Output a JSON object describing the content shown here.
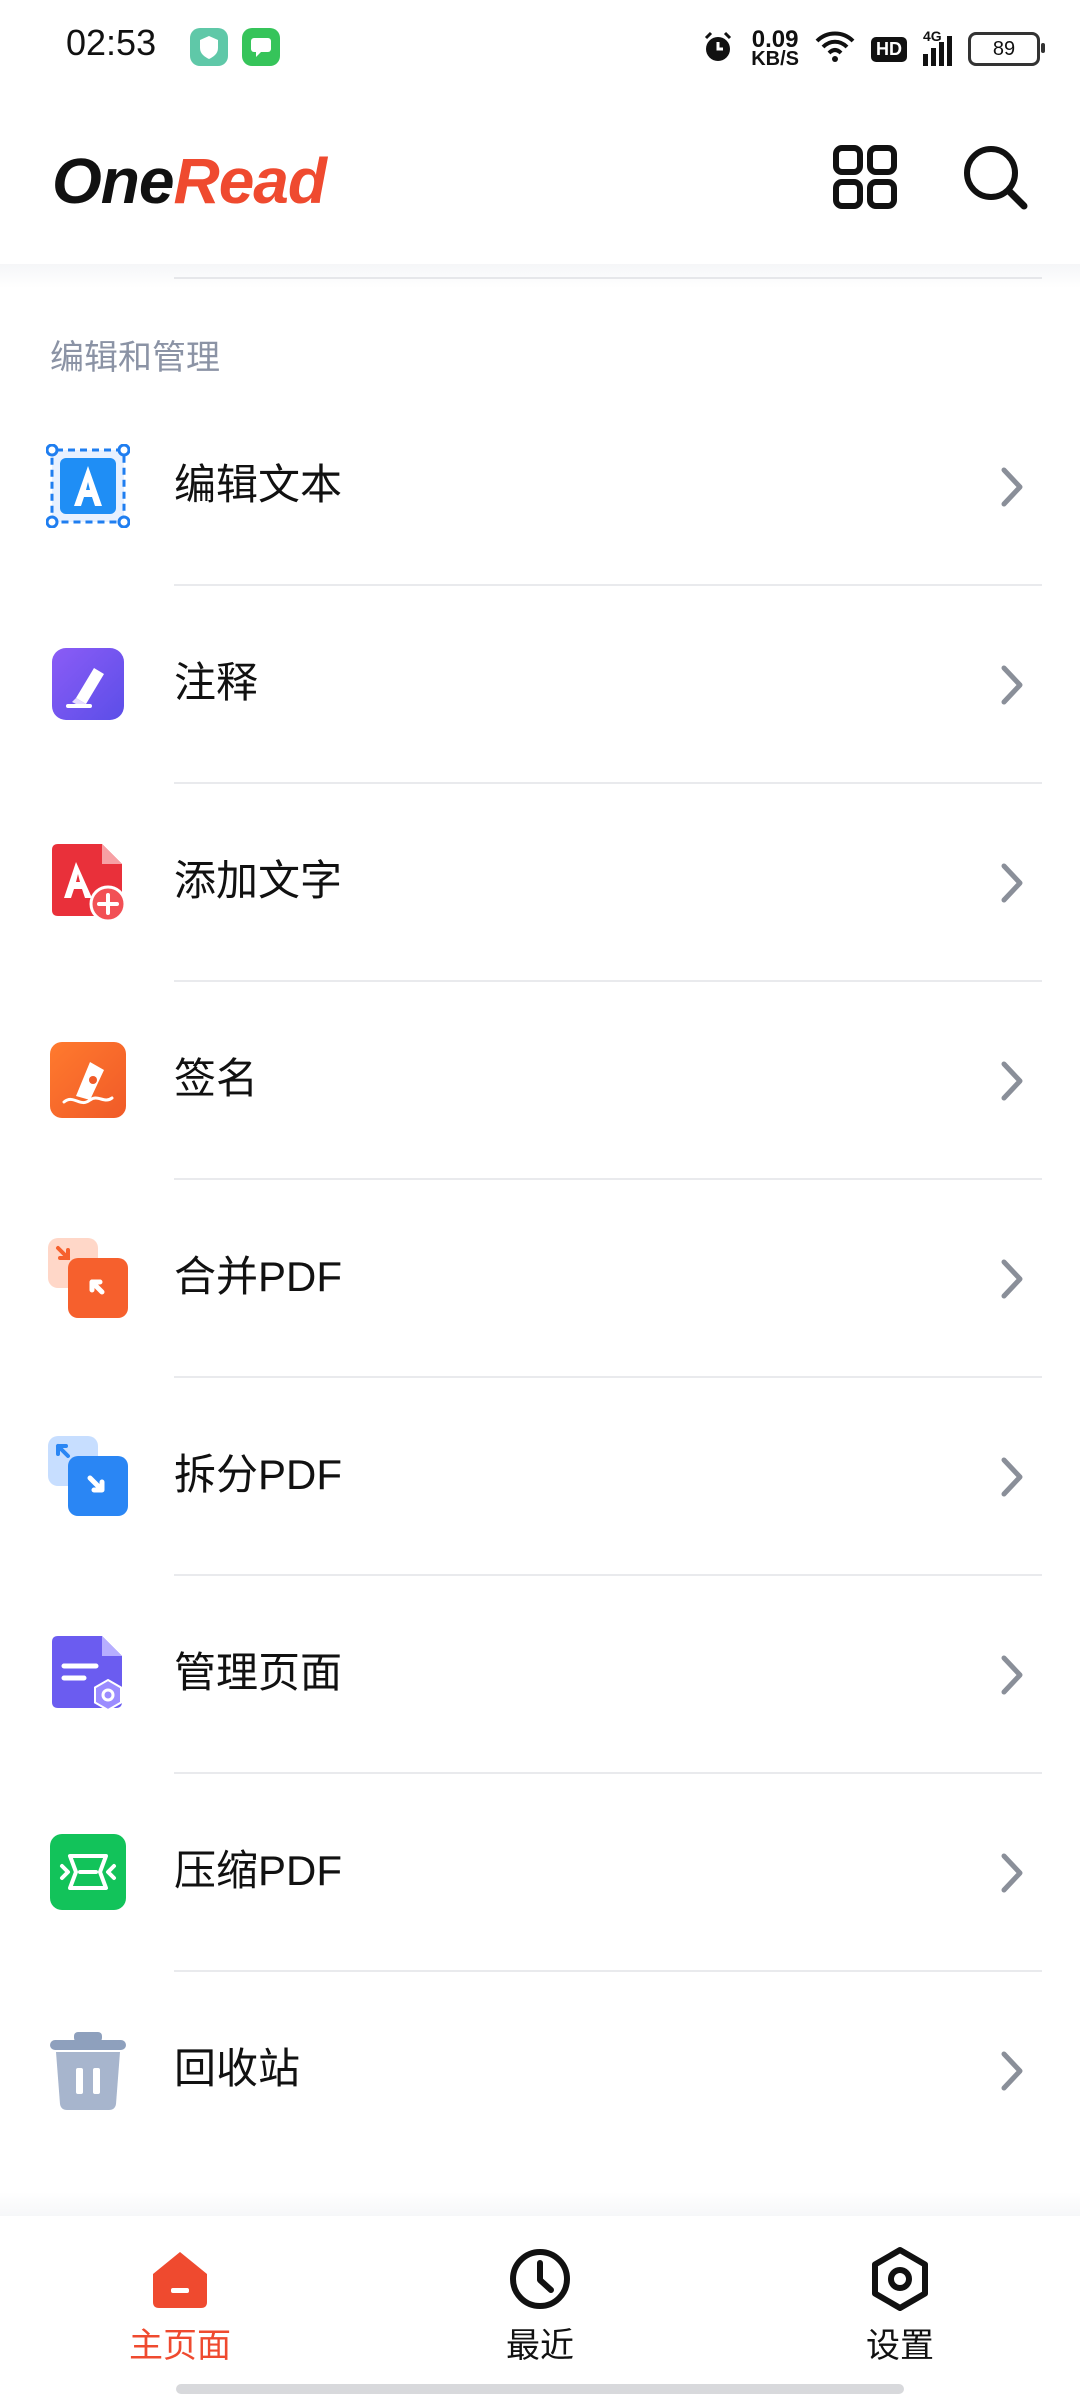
{
  "status_bar": {
    "time": "02:53",
    "net_speed_value": "0.09",
    "net_speed_unit": "KB/S",
    "hd_badge": "HD",
    "network_type": "4G",
    "battery": "89"
  },
  "header": {
    "logo_one": "One",
    "logo_read": "Read",
    "grid_icon": "grid-icon",
    "search_icon": "search-icon"
  },
  "section": {
    "title": "编辑和管理"
  },
  "items": [
    {
      "label": "编辑文本",
      "icon": "edit-text-icon"
    },
    {
      "label": "注释",
      "icon": "annotate-icon"
    },
    {
      "label": "添加文字",
      "icon": "add-text-icon"
    },
    {
      "label": "签名",
      "icon": "signature-icon"
    },
    {
      "label": "合并PDF",
      "icon": "merge-pdf-icon"
    },
    {
      "label": "拆分PDF",
      "icon": "split-pdf-icon"
    },
    {
      "label": "管理页面",
      "icon": "manage-pages-icon"
    },
    {
      "label": "压缩PDF",
      "icon": "compress-pdf-icon"
    },
    {
      "label": "回收站",
      "icon": "recycle-bin-icon"
    }
  ],
  "bottom_nav": {
    "home": "主页面",
    "recent": "最近",
    "settings": "设置"
  },
  "colors": {
    "accent": "#ef4a2f",
    "section_title": "#8b93a5"
  }
}
